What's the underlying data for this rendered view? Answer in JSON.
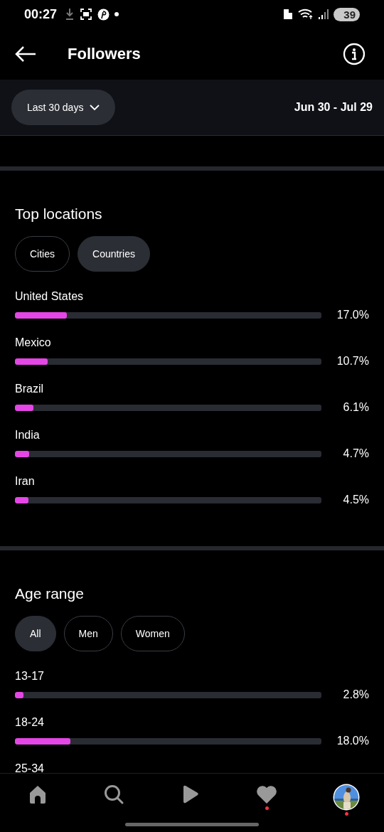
{
  "status_bar": {
    "time": "00:27",
    "battery": "39"
  },
  "header": {
    "title": "Followers"
  },
  "date_bar": {
    "range_button": "Last 30 days",
    "range": "Jun 30 - Jul 29"
  },
  "top_locations": {
    "title": "Top locations",
    "filters": [
      {
        "label": "Cities",
        "selected": false
      },
      {
        "label": "Countries",
        "selected": true
      }
    ],
    "rows": [
      {
        "name": "United States",
        "level": 0.17,
        "value": "17.0%"
      },
      {
        "name": "Mexico",
        "level": 0.107,
        "value": "10.7%"
      },
      {
        "name": "Brazil",
        "level": 0.061,
        "value": "6.1%"
      },
      {
        "name": "India",
        "level": 0.047,
        "value": "4.7%"
      },
      {
        "name": "Iran",
        "level": 0.045,
        "value": "4.5%"
      }
    ]
  },
  "age_range": {
    "title": "Age range",
    "filters": [
      {
        "label": "All",
        "selected": true
      },
      {
        "label": "Men",
        "selected": false
      },
      {
        "label": "Women",
        "selected": false
      }
    ],
    "rows": [
      {
        "name": "13-17",
        "level": 0.028,
        "value": "2.8%"
      },
      {
        "name": "18-24",
        "level": 0.18,
        "value": "18.0%"
      },
      {
        "name": "25-34"
      }
    ]
  },
  "bottom_nav": [
    {
      "kind": "home",
      "badge": false
    },
    {
      "kind": "search",
      "badge": false
    },
    {
      "kind": "reels",
      "badge": false
    },
    {
      "kind": "activity",
      "badge": true
    },
    {
      "kind": "profile",
      "badge": true
    }
  ]
}
